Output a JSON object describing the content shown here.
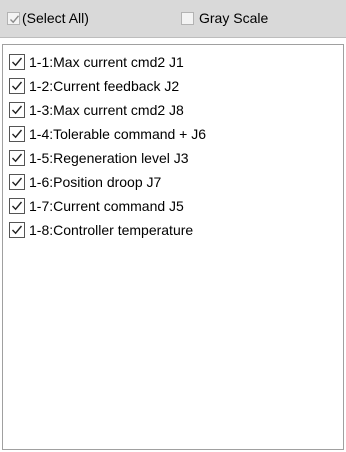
{
  "header": {
    "select_all": {
      "label": "(Select All)",
      "checked": true,
      "enabled": false
    },
    "gray_scale": {
      "label": "Gray Scale",
      "checked": false,
      "enabled": false
    }
  },
  "signal_list": {
    "items": [
      {
        "label": "1-1:Max current cmd2 J1",
        "checked": true
      },
      {
        "label": "1-2:Current feedback J2",
        "checked": true
      },
      {
        "label": "1-3:Max current cmd2 J8",
        "checked": true
      },
      {
        "label": "1-4:Tolerable command + J6",
        "checked": true
      },
      {
        "label": "1-5:Regeneration level J3",
        "checked": true
      },
      {
        "label": "1-6:Position droop J7",
        "checked": true
      },
      {
        "label": "1-7:Current command J5",
        "checked": true
      },
      {
        "label": "1-8:Controller temperature",
        "checked": true
      }
    ]
  },
  "colors": {
    "toolbar_bg": "#d9d9d9",
    "disabled_text": "#000000",
    "checkmark_disabled": "#8a8a8a",
    "checkmark": "#222222",
    "border": "#a0a0a0"
  },
  "icons": {
    "checkmark": "check-icon"
  }
}
